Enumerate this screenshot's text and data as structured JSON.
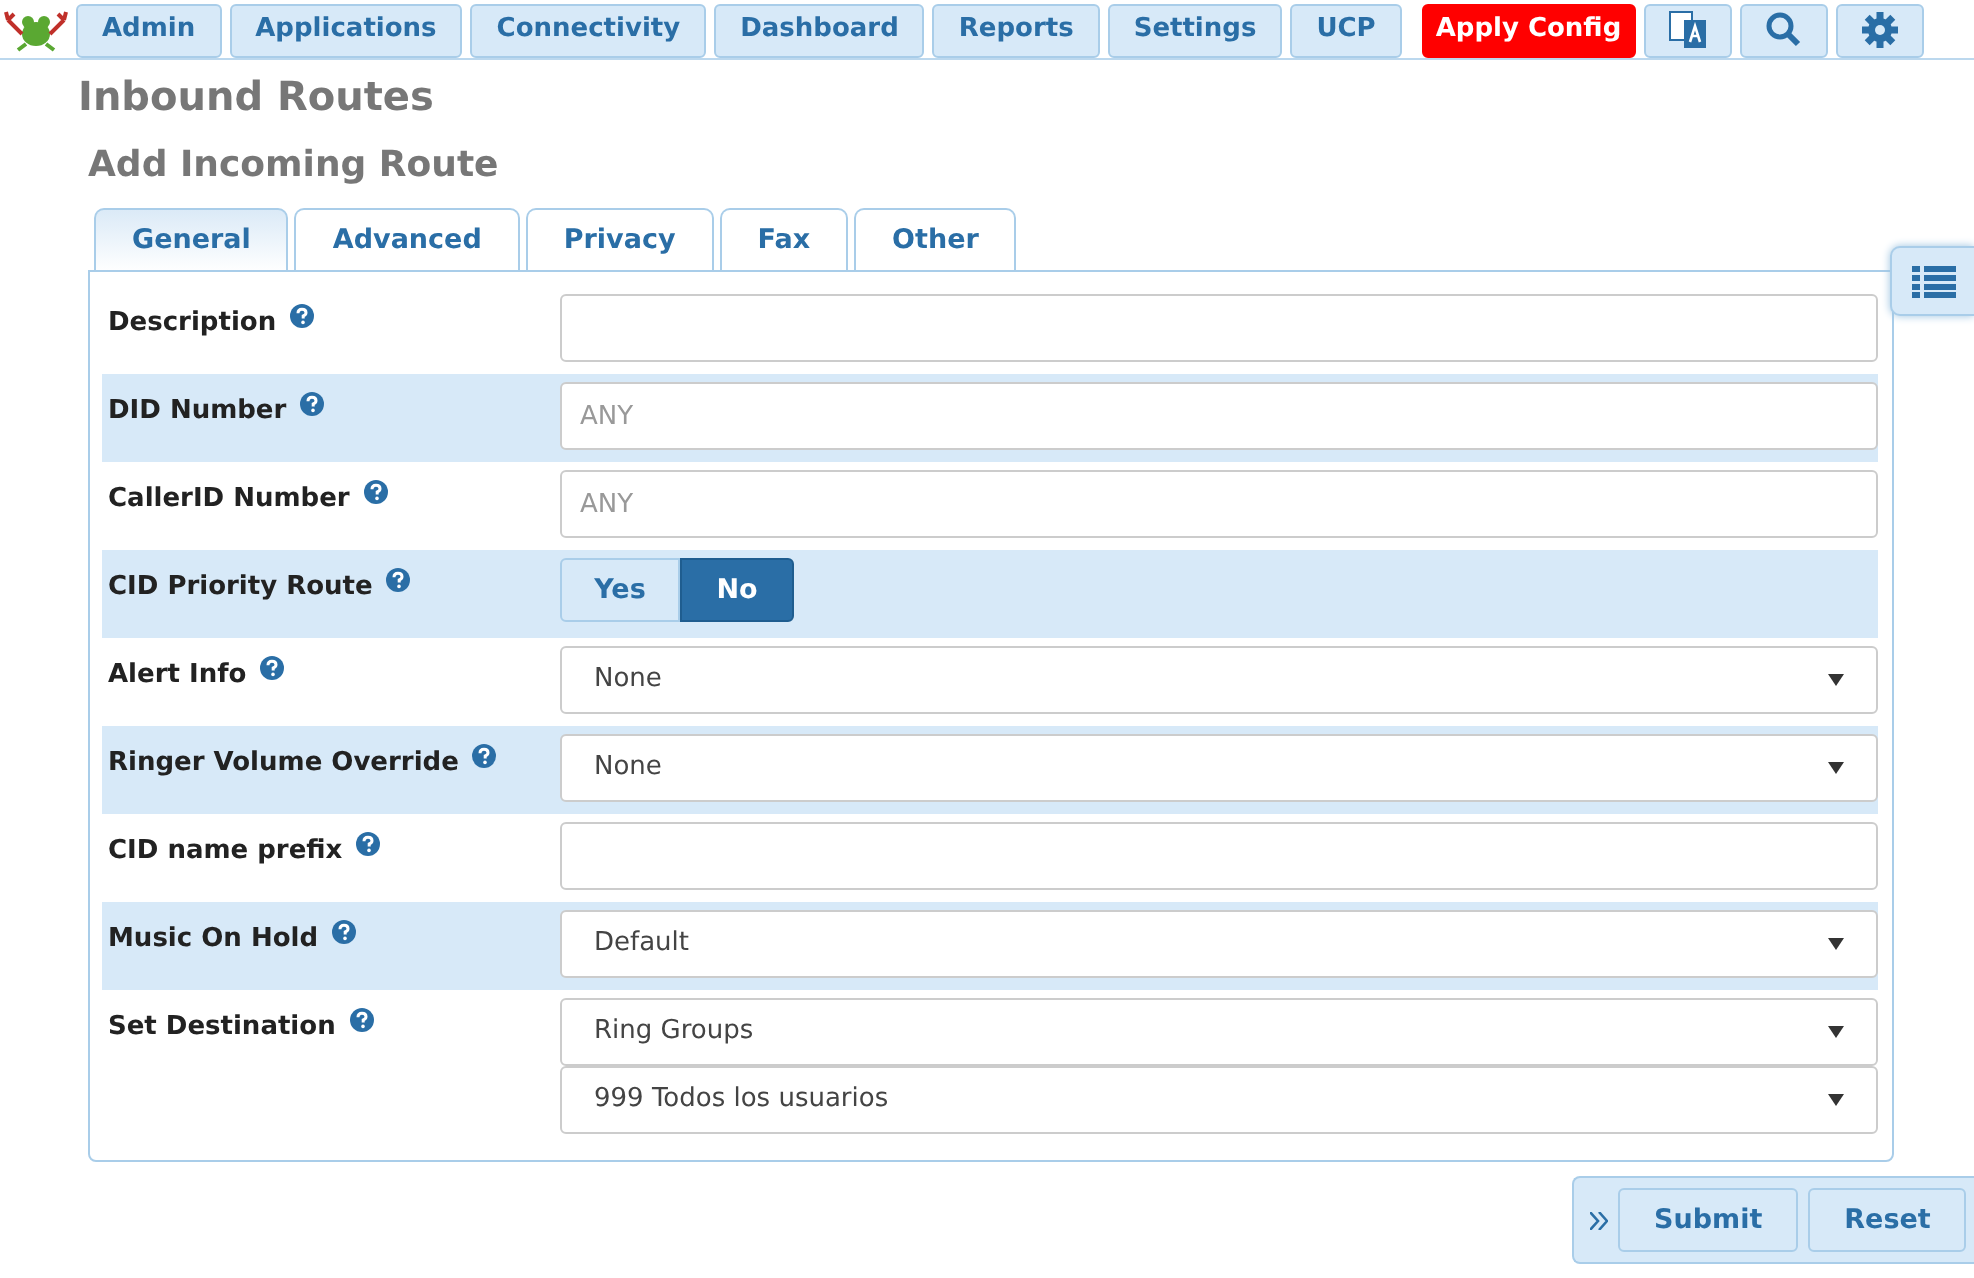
{
  "top_nav": {
    "items": [
      {
        "label": "Admin",
        "kind": "menu"
      },
      {
        "label": "Applications",
        "kind": "menu"
      },
      {
        "label": "Connectivity",
        "kind": "menu"
      },
      {
        "label": "Dashboard",
        "kind": "menu"
      },
      {
        "label": "Reports",
        "kind": "menu"
      },
      {
        "label": "Settings",
        "kind": "menu"
      },
      {
        "label": "UCP",
        "kind": "menu"
      },
      {
        "label": "Apply Config",
        "kind": "alert"
      },
      {
        "kind": "language"
      },
      {
        "kind": "search"
      },
      {
        "kind": "settings"
      }
    ]
  },
  "page_title": "Inbound Routes",
  "section_title": "Add Incoming Route",
  "tabs": [
    {
      "label": "General",
      "selected": true
    },
    {
      "label": "Advanced",
      "selected": false
    },
    {
      "label": "Privacy",
      "selected": false
    },
    {
      "label": "Fax",
      "selected": false
    },
    {
      "label": "Other",
      "selected": false
    }
  ],
  "fields": [
    {
      "label": "Description",
      "kind": "text"
    },
    {
      "label": "DID Number",
      "kind": "text",
      "placeholder": "ANY"
    },
    {
      "label": "CallerID Number",
      "kind": "text",
      "placeholder": "ANY"
    },
    {
      "label": "CID Priority Route",
      "kind": "toggle",
      "options": [
        {
          "label": "Yes",
          "selected": false
        },
        {
          "label": "No",
          "selected": true
        }
      ]
    },
    {
      "label": "Alert Info",
      "kind": "select",
      "values": [
        "None"
      ]
    },
    {
      "label": "Ringer Volume Override",
      "kind": "select",
      "values": [
        "None"
      ]
    },
    {
      "label": "CID name prefix",
      "kind": "text"
    },
    {
      "label": "Music On Hold",
      "kind": "select",
      "values": [
        "Default"
      ]
    },
    {
      "label": "Set Destination",
      "kind": "select",
      "values": [
        "Ring Groups",
        "999 Todos los usuarios"
      ]
    }
  ],
  "actions": [
    {
      "label": "Submit"
    },
    {
      "label": "Reset"
    }
  ]
}
